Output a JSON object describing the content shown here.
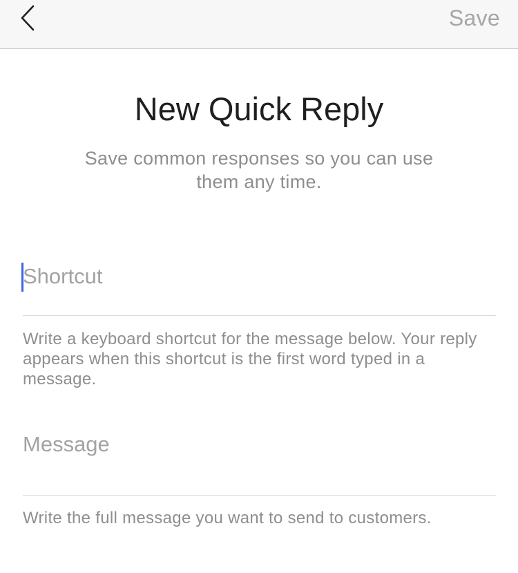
{
  "navbar": {
    "back_icon": "chevron-left-icon",
    "save_label": "Save"
  },
  "header": {
    "title": "New Quick Reply",
    "subtitle": "Save common responses so you can use them any time."
  },
  "shortcut": {
    "placeholder": "Shortcut",
    "value": "",
    "help": "Write a keyboard shortcut for the message below. Your reply appears when this shortcut is the first word typed in a message."
  },
  "message": {
    "placeholder": "Message",
    "value": "",
    "help": "Write the full message you want to send to customers."
  },
  "colors": {
    "caret": "#3b63e0",
    "navbar_bg": "#f7f7f7",
    "muted_text": "#8e8e8e"
  }
}
